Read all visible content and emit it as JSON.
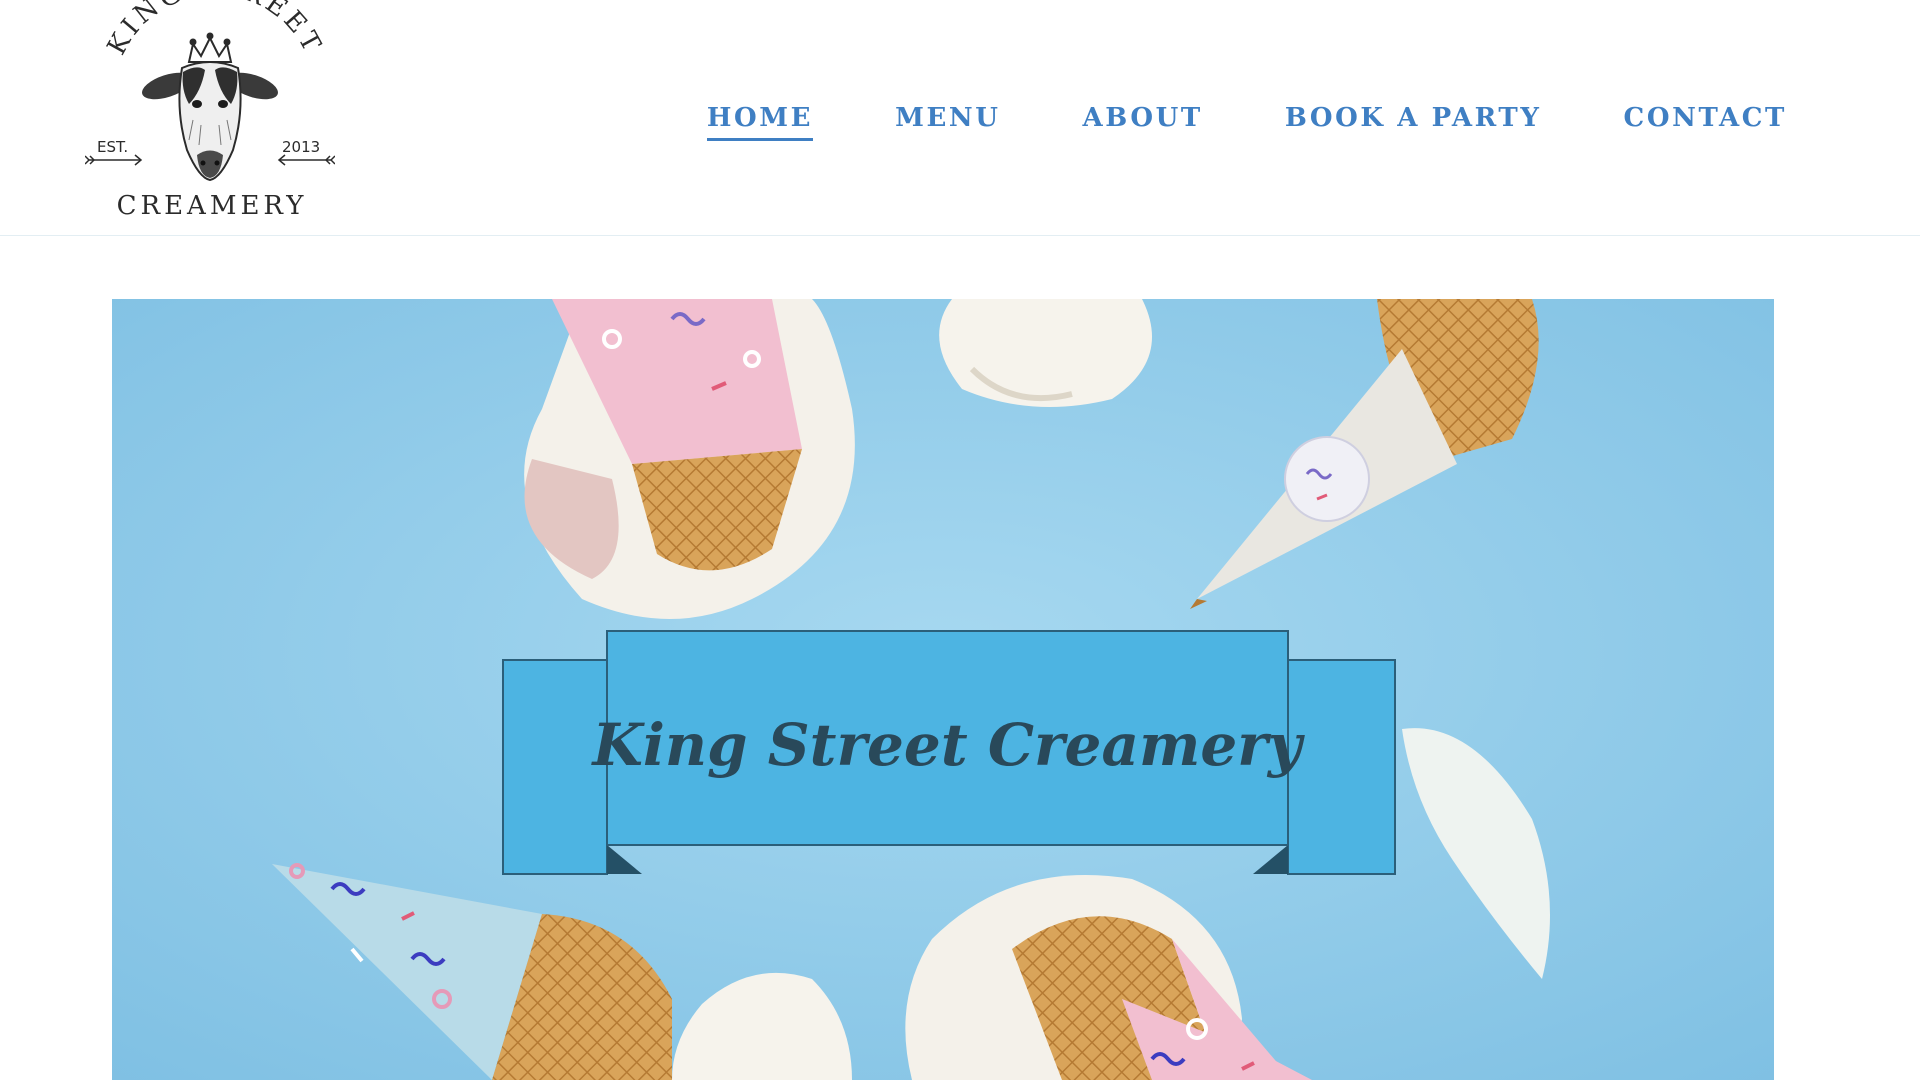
{
  "brand": {
    "logo_top": "KING STREET",
    "logo_bottom": "CREAMERY",
    "est_label": "EST.",
    "est_year": "2013"
  },
  "nav": {
    "items": [
      {
        "label": "HOME",
        "active": true
      },
      {
        "label": "MENU",
        "active": false
      },
      {
        "label": "ABOUT",
        "active": false
      },
      {
        "label": "BOOK A PARTY",
        "active": false
      },
      {
        "label": "CONTACT",
        "active": false
      }
    ]
  },
  "hero": {
    "banner_text": "King Street Creamery"
  },
  "colors": {
    "nav_link": "#3f7fc3",
    "hero_background": "#98d0ec",
    "banner": "#4db4e2",
    "banner_text": "#29495a"
  }
}
